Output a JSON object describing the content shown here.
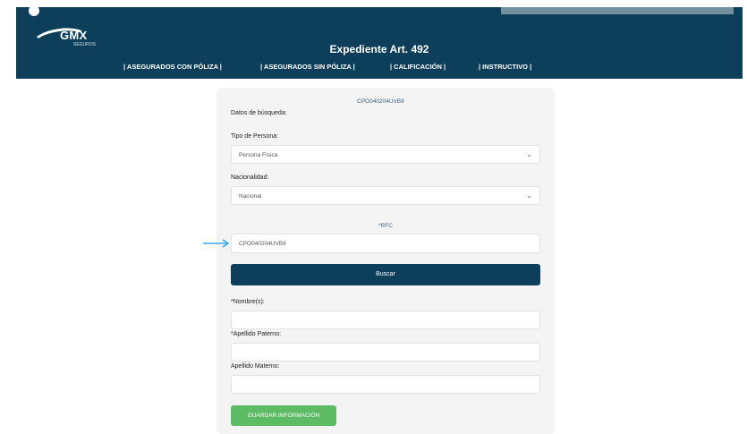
{
  "header": {
    "brand": "GMX",
    "brand_sub": "SEGUROS",
    "title": "Expediente Art. 492"
  },
  "nav": {
    "items": [
      {
        "label": "| ASEGURADOS CON PÓLIZA |"
      },
      {
        "label": "| ASEGURADOS SIN PÓLIZA |"
      },
      {
        "label": "| CALIFICACIÓN |"
      },
      {
        "label": "| INSTRUCTIVO |"
      }
    ]
  },
  "form": {
    "search_code": "CPO040204UVB9",
    "search_data_label": "Datos de búsqueda:",
    "person_type": {
      "label": "Tipo de Persona:",
      "value": "Persona Física"
    },
    "nationality": {
      "label": "Nacionalidad:",
      "value": "Nacional"
    },
    "rfc": {
      "label": "*RFC",
      "value": "CPO040204UVB9"
    },
    "search_button": "Buscar",
    "name": {
      "label": "*Nombre(s):",
      "value": ""
    },
    "last_name_paternal": {
      "label": "*Apellido Paterno:",
      "value": ""
    },
    "last_name_maternal": {
      "label": "Apellido Materno:",
      "value": ""
    },
    "save_button": "GUARDAR INFORMACIÓN"
  },
  "colors": {
    "header_bg": "#0d3f5b",
    "search_button_bg": "#0d3f5b",
    "save_button_bg": "#5dbb63",
    "arrow": "#3aa8e8",
    "card_bg": "#f4f4f4"
  },
  "icons": {
    "select_chevron": "chevron-down-icon",
    "pointer": "arrow-right-icon"
  }
}
